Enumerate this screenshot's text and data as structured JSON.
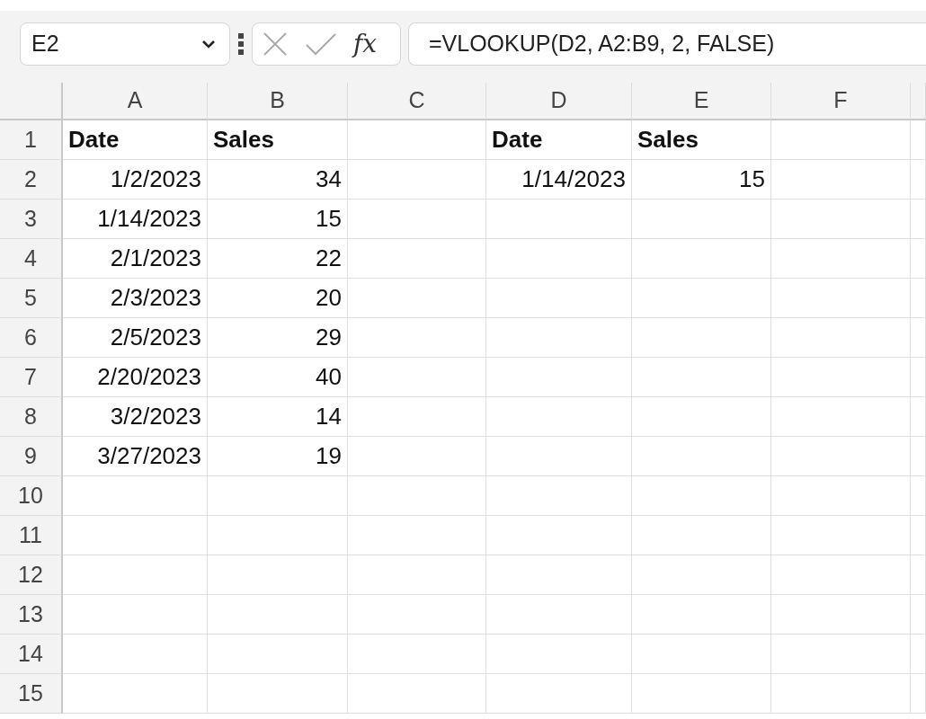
{
  "name_box": {
    "value": "E2"
  },
  "formula_bar": {
    "function_label": "fx",
    "value": "=VLOOKUP(D2, A2:B9, 2, FALSE)"
  },
  "columns": [
    "A",
    "B",
    "C",
    "D",
    "E",
    "F"
  ],
  "rows": [
    {
      "header": "1",
      "kind": "header",
      "cells": {
        "A": "Date",
        "B": "Sales",
        "D": "Date",
        "E": "Sales"
      }
    },
    {
      "header": "2",
      "kind": "data",
      "cells": {
        "A": "1/2/2023",
        "B": "34",
        "D": "1/14/2023",
        "E": "15"
      }
    },
    {
      "header": "3",
      "kind": "data",
      "cells": {
        "A": "1/14/2023",
        "B": "15"
      }
    },
    {
      "header": "4",
      "kind": "data",
      "cells": {
        "A": "2/1/2023",
        "B": "22"
      }
    },
    {
      "header": "5",
      "kind": "data",
      "cells": {
        "A": "2/3/2023",
        "B": "20"
      }
    },
    {
      "header": "6",
      "kind": "data",
      "cells": {
        "A": "2/5/2023",
        "B": "29"
      }
    },
    {
      "header": "7",
      "kind": "data",
      "cells": {
        "A": "2/20/2023",
        "B": "40"
      }
    },
    {
      "header": "8",
      "kind": "data",
      "cells": {
        "A": "3/2/2023",
        "B": "14"
      }
    },
    {
      "header": "9",
      "kind": "data",
      "cells": {
        "A": "3/27/2023",
        "B": "19"
      }
    },
    {
      "header": "10",
      "kind": "data"
    },
    {
      "header": "11",
      "kind": "data"
    },
    {
      "header": "12",
      "kind": "data"
    },
    {
      "header": "13",
      "kind": "data"
    },
    {
      "header": "14",
      "kind": "data"
    },
    {
      "header": "15",
      "kind": "data"
    }
  ]
}
